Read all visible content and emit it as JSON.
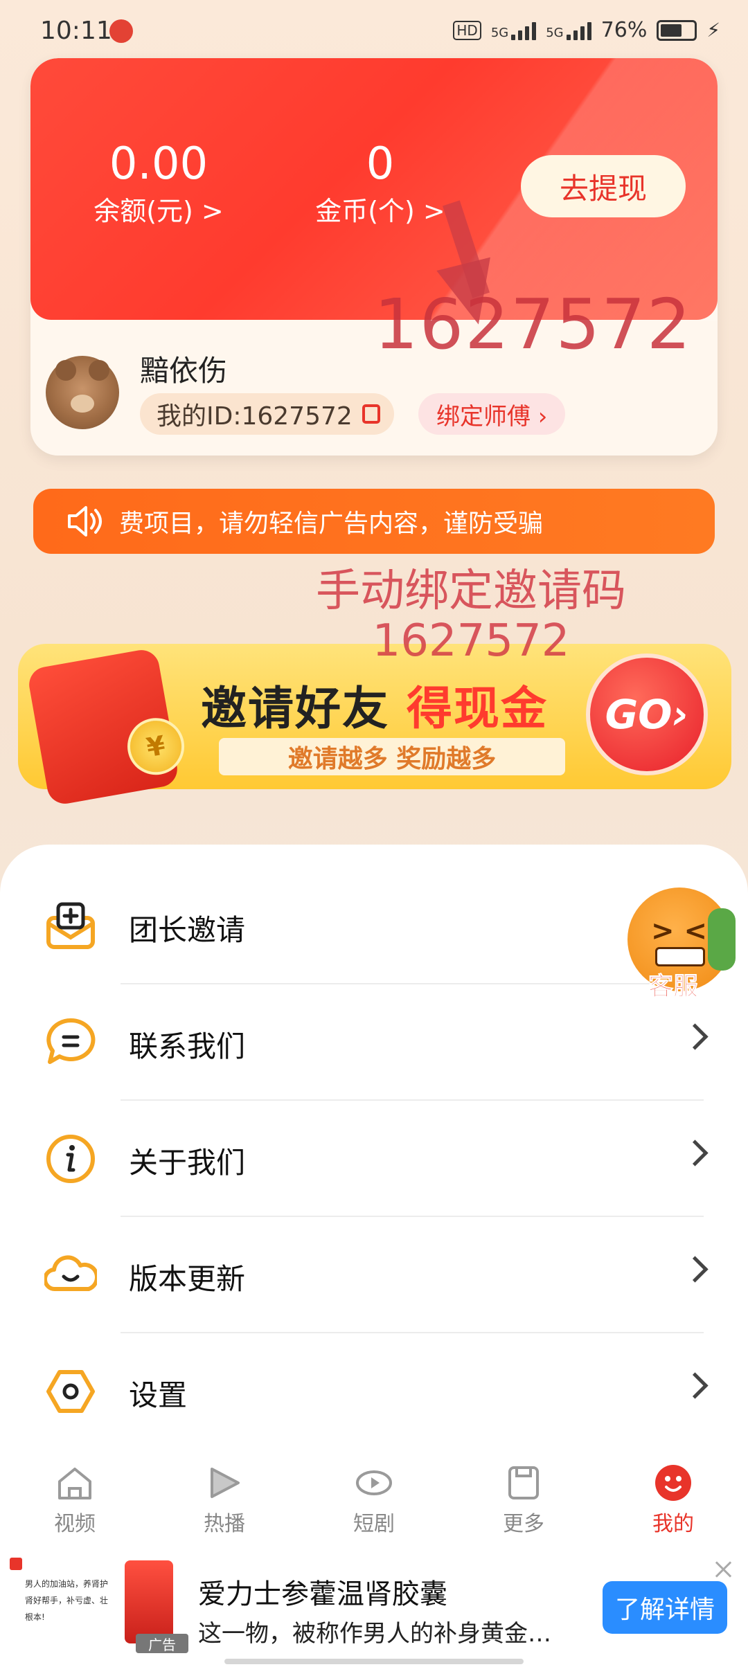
{
  "status_bar": {
    "time": "10:11",
    "hd": "HD",
    "net1": "5G",
    "net2": "5G",
    "battery": "76%"
  },
  "account": {
    "balance_value": "0.00",
    "balance_label": "余额(元) >",
    "coins_value": "0",
    "coins_label": "金币(个) >",
    "withdraw_label": "去提现",
    "username": "黯依伤",
    "user_id": "我的ID:1627572",
    "bind_master": "绑定师傅 ›"
  },
  "overlays": {
    "big_id": "1627572",
    "invite_code": "手动绑定邀请码1627572"
  },
  "notice": {
    "text": "费项目，请勿轻信广告内容，谨防受骗"
  },
  "promo": {
    "title_part1": "邀请好友",
    "title_part2": "得现金",
    "subtitle": "邀请越多 奖励越多",
    "go_label": "GO›",
    "coin_symbol": "¥"
  },
  "menu": {
    "items": [
      {
        "label": "团长邀请",
        "icon": "envelope-plus-icon"
      },
      {
        "label": "联系我们",
        "icon": "chat-bubble-icon"
      },
      {
        "label": "关于我们",
        "icon": "info-icon"
      },
      {
        "label": "版本更新",
        "icon": "cloud-smile-icon"
      },
      {
        "label": "设置",
        "icon": "hexagon-settings-icon"
      }
    ]
  },
  "customer_service": {
    "label": "客服",
    "eyes": "> <"
  },
  "nav": {
    "items": [
      {
        "label": "视频",
        "icon": "home-icon"
      },
      {
        "label": "热播",
        "icon": "play-icon"
      },
      {
        "label": "短剧",
        "icon": "eye-play-icon"
      },
      {
        "label": "更多",
        "icon": "square-icon"
      },
      {
        "label": "我的",
        "icon": "profile-icon"
      }
    ],
    "active_index": 4
  },
  "ad": {
    "thumb_text": "男人的加油站，养肾护肾好帮手，补亏虚、壮根本!",
    "ad_label": "广告",
    "title": "爱力士参藿温肾胶囊",
    "description": "这一物，被称作男人的补身黄金…",
    "cta": "了解详情"
  },
  "colors": {
    "accent_red": "#ff3b2e",
    "notice_orange": "#ff6a1a",
    "ad_blue": "#2a8dff",
    "icon_orange": "#f5a623"
  }
}
